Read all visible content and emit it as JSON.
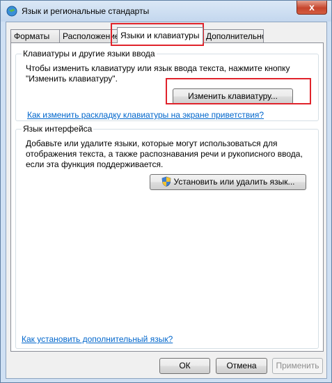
{
  "window": {
    "title": "Язык и региональные стандарты",
    "close_label": "x"
  },
  "tabs": [
    {
      "label": "Форматы"
    },
    {
      "label": "Расположение"
    },
    {
      "label": "Языки и клавиатуры",
      "active": true
    },
    {
      "label": "Дополнительно"
    }
  ],
  "keyboards": {
    "legend": "Клавиатуры и другие языки ввода",
    "description": "Чтобы изменить клавиатуру или язык ввода текста, нажмите кнопку \"Изменить клавиатуру\".",
    "change_button": "Изменить клавиатуру...",
    "help_link": "Как изменить раскладку клавиатуры на экране приветствия?"
  },
  "ui_language": {
    "legend": "Язык интерфейса",
    "description": "Добавьте или удалите языки, которые могут использоваться для отображения текста, а также распознавания речи и рукописного ввода, если эта функция поддерживается.",
    "install_button": "Установить или удалить язык..."
  },
  "footer": {
    "link": "Как установить дополнительный язык?",
    "ok": "ОК",
    "cancel": "Отмена",
    "apply": "Применить"
  },
  "colors": {
    "highlight": "#e0232b",
    "link": "#0066cc"
  }
}
